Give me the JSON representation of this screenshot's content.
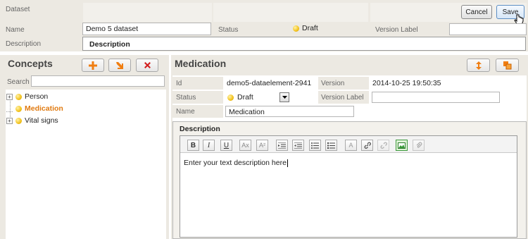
{
  "dataset": {
    "dataset_label": "Dataset",
    "name_label": "Name",
    "name_value": "Demo 5 dataset",
    "status_label": "Status",
    "status_value": "Draft",
    "version_label_label": "Version Label",
    "version_label_value": "",
    "description_label": "Description",
    "description_tab": "Description",
    "cancel_label": "Cancel",
    "save_label": "Save"
  },
  "concepts": {
    "title": "Concepts",
    "search_label": "Search",
    "search_value": "",
    "tree": [
      {
        "label": "Person",
        "expandable": true,
        "selected": false
      },
      {
        "label": "Medication",
        "expandable": false,
        "selected": true
      },
      {
        "label": "Vital signs",
        "expandable": true,
        "selected": false
      }
    ]
  },
  "detail": {
    "title": "Medication",
    "id_label": "Id",
    "id_value": "demo5-dataelement-2941",
    "version_label": "Version",
    "version_value": "2014-10-25 19:50:35",
    "status_label": "Status",
    "status_value": "Draft",
    "version_label_label": "Version Label",
    "version_label_value": "",
    "name_label": "Name",
    "name_value": "Medication",
    "description_header": "Description",
    "editor_text": "Enter your text description here",
    "toolbar": [
      "B",
      "I",
      "U",
      "Ax",
      "A²",
      "outdent",
      "indent",
      "ul",
      "ol",
      "format",
      "link",
      "unlink",
      "image",
      "attach"
    ]
  },
  "colors": {
    "accent_orange": "#e07a10",
    "delete_red": "#d21f1f",
    "panel_bg": "#ece9e2",
    "selected_text": "#e07a10"
  }
}
